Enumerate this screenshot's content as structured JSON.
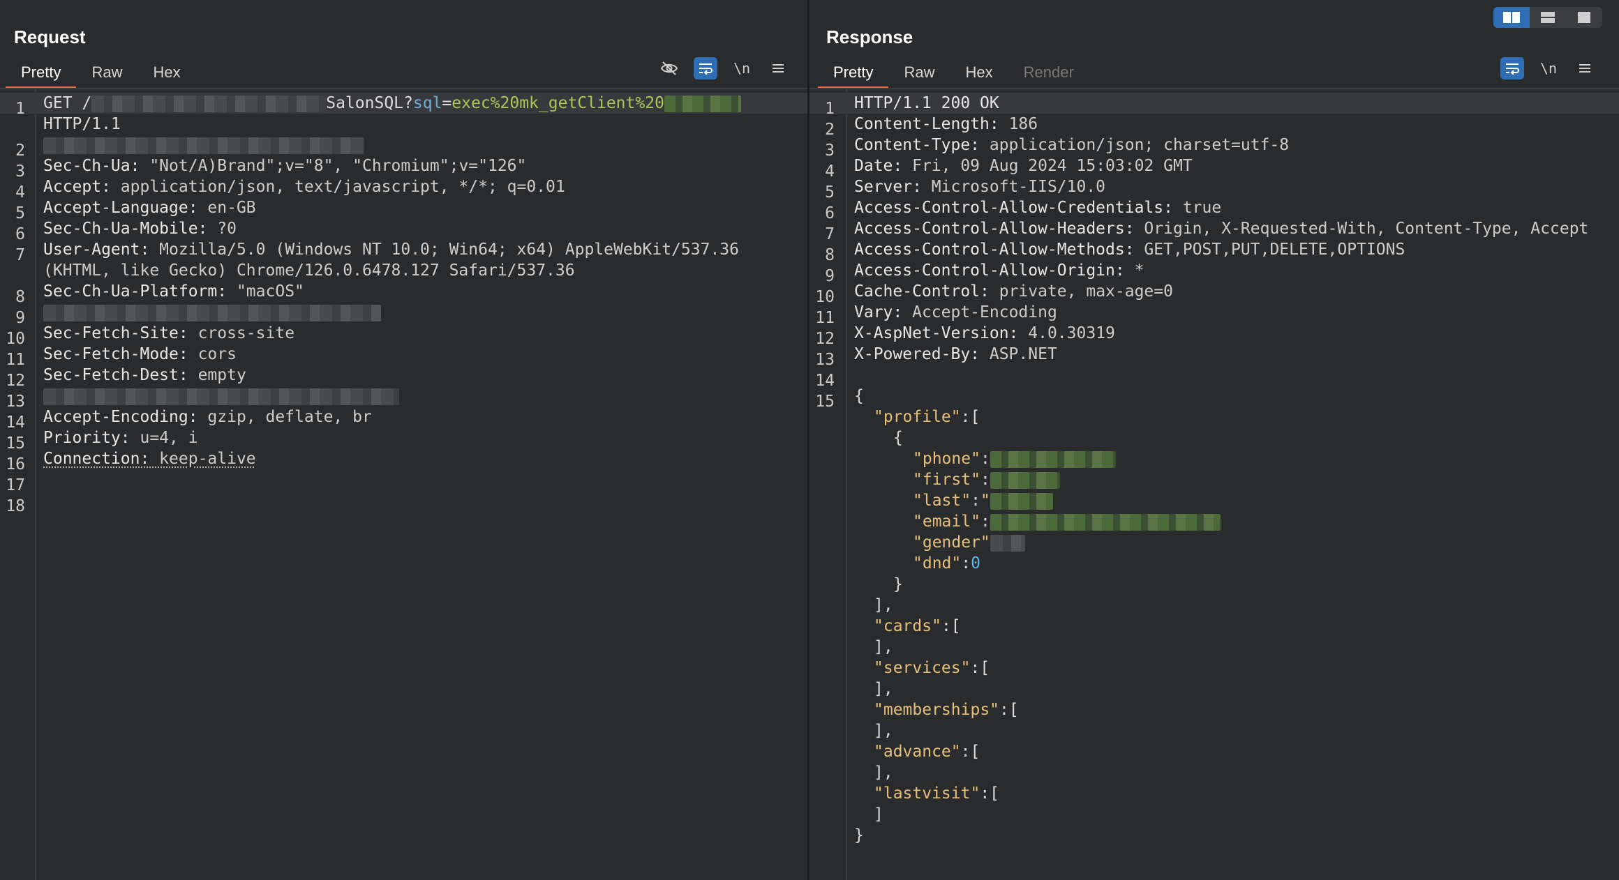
{
  "request": {
    "title": "Request",
    "tabs": [
      "Pretty",
      "Raw",
      "Hex"
    ],
    "active_tab": "Pretty",
    "tools": [
      "eye-off-icon",
      "wrap-icon",
      "newline-icon",
      "menu-icon"
    ],
    "newline_label": "\\n",
    "lines": {
      "l1a": "GET /",
      "l1b": "SalonSQL?",
      "l1c": "sql",
      "l1d": "=",
      "l1e": "exec%20mk_getClient%20",
      "l1f": "HTTP/1.1",
      "l3k": "Sec-Ch-Ua:",
      "l3v": " \"Not/A)Brand\";v=\"8\", \"Chromium\";v=\"126\"",
      "l4k": "Accept:",
      "l4v": " application/json, text/javascript, */*; q=0.01",
      "l5k": "Accept-Language:",
      "l5v": " en-GB",
      "l6k": "Sec-Ch-Ua-Mobile:",
      "l6v": " ?0",
      "l7k": "User-Agent:",
      "l7v": " Mozilla/5.0 (Windows NT 10.0; Win64; x64) AppleWebKit/537.36",
      "l7w": "(KHTML, like Gecko) Chrome/126.0.6478.127 Safari/537.36",
      "l8k": "Sec-Ch-Ua-Platform:",
      "l8v": " \"macOS\"",
      "l10k": "Sec-Fetch-Site:",
      "l10v": " cross-site",
      "l11k": "Sec-Fetch-Mode:",
      "l11v": " cors",
      "l12k": "Sec-Fetch-Dest:",
      "l12v": " empty",
      "l14k": "Accept-Encoding:",
      "l14v": " gzip, deflate, br",
      "l15k": "Priority:",
      "l15v": " u=4, i",
      "l16k": "Connection:",
      "l16v": " keep-alive"
    },
    "line_numbers": [
      "1",
      "2",
      "3",
      "4",
      "5",
      "6",
      "7",
      "8",
      "9",
      "10",
      "11",
      "12",
      "13",
      "14",
      "15",
      "16",
      "17",
      "18"
    ]
  },
  "response": {
    "title": "Response",
    "tabs": [
      "Pretty",
      "Raw",
      "Hex",
      "Render"
    ],
    "active_tab": "Pretty",
    "tools": [
      "wrap-icon",
      "newline-icon",
      "menu-icon"
    ],
    "newline_label": "\\n",
    "line_numbers": [
      "1",
      "2",
      "3",
      "4",
      "5",
      "6",
      "7",
      "8",
      "9",
      "10",
      "11",
      "12",
      "13",
      "14",
      "15"
    ],
    "lines": {
      "l1": "HTTP/1.1 200 OK",
      "l2k": "Content-Length:",
      "l2v": " 186",
      "l3k": "Content-Type:",
      "l3v": " application/json; charset=utf-8",
      "l4k": "Date:",
      "l4v": " Fri, 09 Aug 2024 15:03:02 GMT",
      "l5k": "Server:",
      "l5v": " Microsoft-IIS/10.0",
      "l6k": "Access-Control-Allow-Credentials:",
      "l6v": " true",
      "l7k": "Access-Control-Allow-Headers:",
      "l7v": " Origin, X-Requested-With, Content-Type, Accept",
      "l8k": "Access-Control-Allow-Methods:",
      "l8v": " GET,POST,PUT,DELETE,OPTIONS",
      "l9k": "Access-Control-Allow-Origin:",
      "l9v": " *",
      "l10k": "Cache-Control:",
      "l10v": " private, max-age=0",
      "l11k": "Vary:",
      "l11v": " Accept-Encoding",
      "l12k": "X-AspNet-Version:",
      "l12v": " 4.0.30319",
      "l13k": "X-Powered-By:",
      "l13v": " ASP.NET",
      "j_open": "{",
      "j_profile": "\"profile\"",
      "j_colon_bracket": ":[",
      "j_obj_open": "{",
      "j_phone": "\"phone\"",
      "j_first": "\"first\"",
      "j_last": "\"last\"",
      "j_email": "\"email\"",
      "j_gender": "\"gender\"",
      "j_dnd": "\"dnd\"",
      "j_dnd_val": "0",
      "j_obj_close": "}",
      "j_arr_close_comma": "],",
      "j_cards": "\"cards\"",
      "j_services": "\"services\"",
      "j_memberships": "\"memberships\"",
      "j_advance": "\"advance\"",
      "j_lastvisit": "\"lastvisit\"",
      "j_arr_close": "]",
      "j_close": "}"
    }
  },
  "layout_buttons": [
    "split-horizontal-icon",
    "split-vertical-icon",
    "single-pane-icon"
  ]
}
